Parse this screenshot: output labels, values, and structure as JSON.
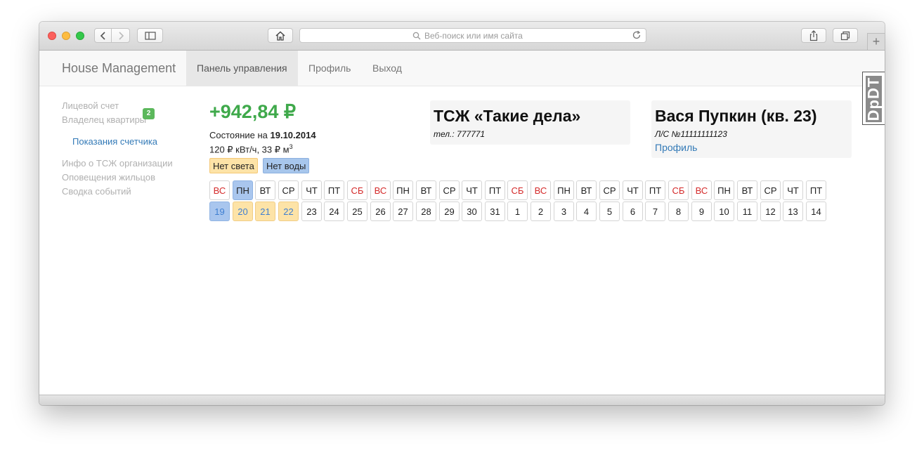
{
  "browser": {
    "address_placeholder": "Веб-поиск или имя сайта",
    "new_tab_label": "+"
  },
  "navbar": {
    "brand": "House Management",
    "items": [
      {
        "label": "Панель управления",
        "active": true
      },
      {
        "label": "Профиль",
        "active": false
      },
      {
        "label": "Выход",
        "active": false
      }
    ]
  },
  "sidebar": {
    "items": [
      {
        "label": "Лицевой счет",
        "active": false
      },
      {
        "label": "Владелец квартиры",
        "active": false
      },
      {
        "label": "Показания счетчика",
        "active": true
      },
      {
        "label": "Инфо о ТСЖ организации",
        "active": false
      },
      {
        "label": "Оповещения жильцов",
        "active": false
      },
      {
        "label": "Сводка событий",
        "active": false
      }
    ],
    "events_badge": "2"
  },
  "account": {
    "balance": "+942,84 ₽",
    "state_prefix": "Состояние на ",
    "state_date": "19.10.2014",
    "rates_text": "120 ₽ кВт/ч, 33 ₽ м",
    "rates_sup": "3",
    "labels": [
      "Нет света",
      "Нет воды"
    ]
  },
  "hoa_panel": {
    "title": "ТСЖ «Такие дела»",
    "phone": "тел.: 777771"
  },
  "user_panel": {
    "title": "Вася Пупкин (кв. 23)",
    "account_no": "Л/С №11111111123",
    "profile_link": "Профиль"
  },
  "calendar": {
    "days": [
      {
        "wd": "ВС",
        "d": "19",
        "weekend": true,
        "state": "blue"
      },
      {
        "wd": "ПН",
        "d": "20",
        "weekend": false,
        "state": "blue-yellow"
      },
      {
        "wd": "ВТ",
        "d": "21",
        "weekend": false,
        "state": "yellow"
      },
      {
        "wd": "СР",
        "d": "22",
        "weekend": false,
        "state": "yellow"
      },
      {
        "wd": "ЧТ",
        "d": "23",
        "weekend": false,
        "state": ""
      },
      {
        "wd": "ПТ",
        "d": "24",
        "weekend": false,
        "state": ""
      },
      {
        "wd": "СБ",
        "d": "25",
        "weekend": true,
        "state": ""
      },
      {
        "wd": "ВС",
        "d": "26",
        "weekend": true,
        "state": ""
      },
      {
        "wd": "ПН",
        "d": "27",
        "weekend": false,
        "state": ""
      },
      {
        "wd": "ВТ",
        "d": "28",
        "weekend": false,
        "state": ""
      },
      {
        "wd": "СР",
        "d": "29",
        "weekend": false,
        "state": ""
      },
      {
        "wd": "ЧТ",
        "d": "30",
        "weekend": false,
        "state": ""
      },
      {
        "wd": "ПТ",
        "d": "31",
        "weekend": false,
        "state": ""
      },
      {
        "wd": "СБ",
        "d": "1",
        "weekend": true,
        "state": ""
      },
      {
        "wd": "ВС",
        "d": "2",
        "weekend": true,
        "state": ""
      },
      {
        "wd": "ПН",
        "d": "3",
        "weekend": false,
        "state": ""
      },
      {
        "wd": "ВТ",
        "d": "4",
        "weekend": false,
        "state": ""
      },
      {
        "wd": "СР",
        "d": "5",
        "weekend": false,
        "state": ""
      },
      {
        "wd": "ЧТ",
        "d": "6",
        "weekend": false,
        "state": ""
      },
      {
        "wd": "ПТ",
        "d": "7",
        "weekend": false,
        "state": ""
      },
      {
        "wd": "СБ",
        "d": "8",
        "weekend": true,
        "state": ""
      },
      {
        "wd": "ВС",
        "d": "9",
        "weekend": true,
        "state": ""
      },
      {
        "wd": "ПН",
        "d": "10",
        "weekend": false,
        "state": ""
      },
      {
        "wd": "ВТ",
        "d": "11",
        "weekend": false,
        "state": ""
      },
      {
        "wd": "СР",
        "d": "12",
        "weekend": false,
        "state": ""
      },
      {
        "wd": "ЧТ",
        "d": "13",
        "weekend": false,
        "state": ""
      },
      {
        "wd": "ПТ",
        "d": "14",
        "weekend": false,
        "state": ""
      }
    ]
  },
  "extension_badge": "DpDT",
  "colors": {
    "accent_link": "#337ab7",
    "balance_green": "#3fa94b",
    "weekend_red": "#d42a2a",
    "power_outage_yellow": "#fde3a7",
    "water_outage_blue": "#a7c6ec"
  }
}
